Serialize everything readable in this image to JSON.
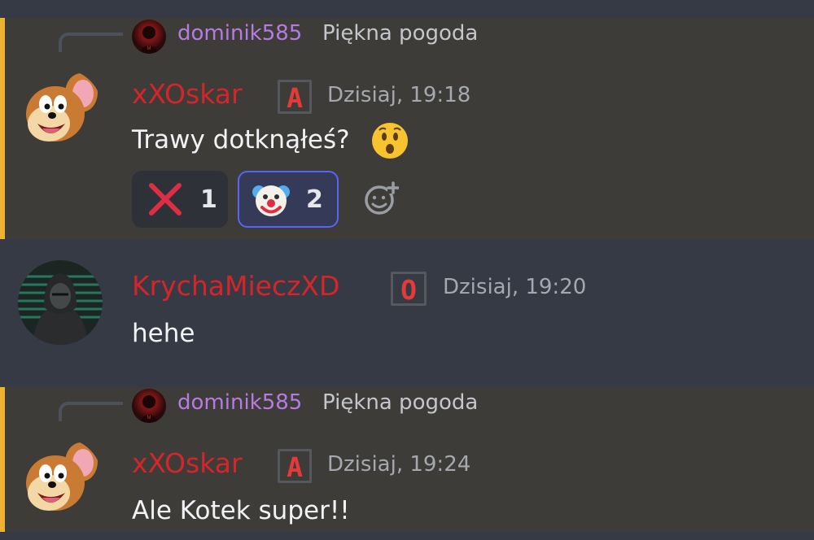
{
  "messages": [
    {
      "reply": {
        "author": "dominik585",
        "text": "Piękna pogoda"
      },
      "author": "xXOskar",
      "role": "A",
      "timestamp": "Dzisiaj, 19:18",
      "content": "Trawy dotknąłeś?",
      "reactions": [
        {
          "emoji": "cross-mark-icon",
          "count": "1"
        },
        {
          "emoji": "clown-face-icon",
          "count": "2"
        }
      ]
    },
    {
      "author": "KrychaMieczXD",
      "role": "O",
      "timestamp": "Dzisiaj, 19:20",
      "content": "hehe"
    },
    {
      "reply": {
        "author": "dominik585",
        "text": "Piękna pogoda"
      },
      "author": "xXOskar",
      "role": "A",
      "timestamp": "Dzisiaj, 19:24",
      "content": "Ale Kotek super!!"
    }
  ],
  "colors": {
    "mention_bar": "#f0b232",
    "author_red": "#d4252a",
    "reply_author": "#b67be3",
    "reaction_active_border": "#5865f2"
  }
}
